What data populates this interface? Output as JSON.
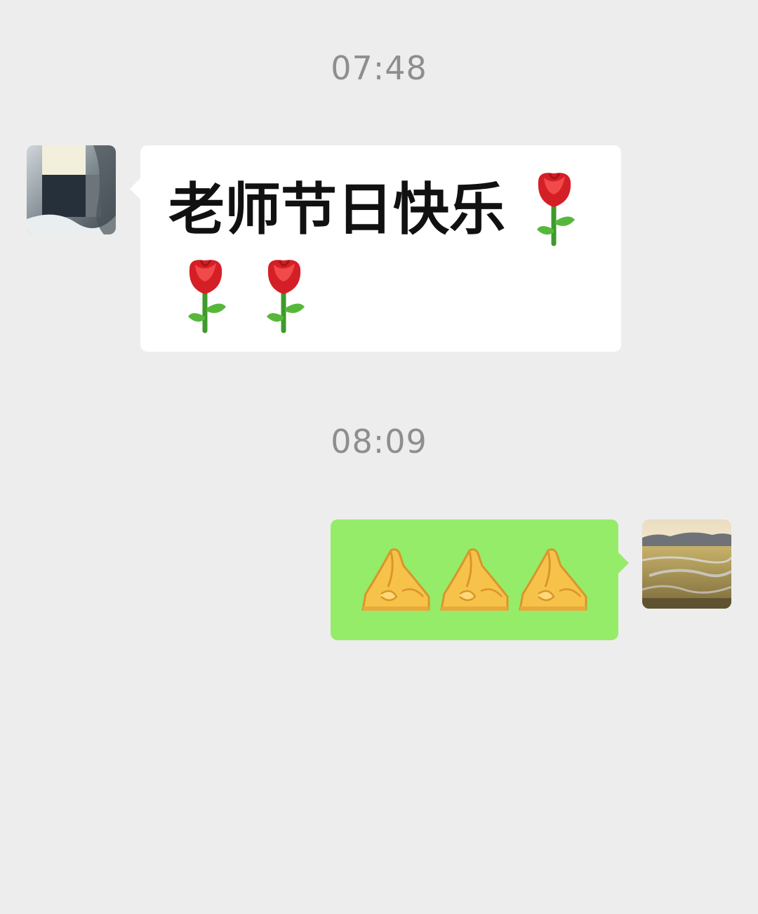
{
  "chat": {
    "messages": [
      {
        "timestamp": "07:48",
        "sender": "left",
        "text": "老师节日快乐",
        "emoji": [
          "rose",
          "rose",
          "rose"
        ]
      },
      {
        "timestamp": "08:09",
        "sender": "right",
        "emoji": [
          "folded-hands",
          "folded-hands",
          "folded-hands"
        ]
      }
    ]
  },
  "colors": {
    "background": "#ededed",
    "incoming_bubble": "#ffffff",
    "outgoing_bubble": "#95ec69",
    "timestamp": "#8e8e8e"
  }
}
